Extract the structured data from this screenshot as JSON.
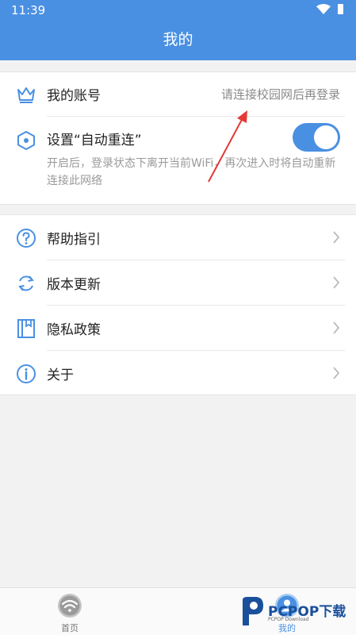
{
  "status_bar": {
    "time": "11:39"
  },
  "header": {
    "title": "我的"
  },
  "account": {
    "label": "我的账号",
    "value": "请连接校园网后再登录"
  },
  "reconnect": {
    "label": "设置“自动重连”",
    "toggle_on": true,
    "description": "开启后，登录状态下离开当前WiFi，再次进入时将自动重新连接此网络"
  },
  "menu": [
    {
      "label": "帮助指引",
      "icon": "help-icon"
    },
    {
      "label": "版本更新",
      "icon": "refresh-icon"
    },
    {
      "label": "隐私政策",
      "icon": "book-icon"
    },
    {
      "label": "关于",
      "icon": "info-icon"
    }
  ],
  "tabs": {
    "home": {
      "label": "首页",
      "icon": "wifi-icon"
    },
    "mine": {
      "label": "我的",
      "icon": "user-icon"
    }
  },
  "watermark": {
    "text": "PCPOP下载",
    "sub": "PCPOP Download"
  },
  "colors": {
    "primary": "#4a90e2",
    "background": "#f2f2f2",
    "annotation_arrow": "#e53935"
  }
}
